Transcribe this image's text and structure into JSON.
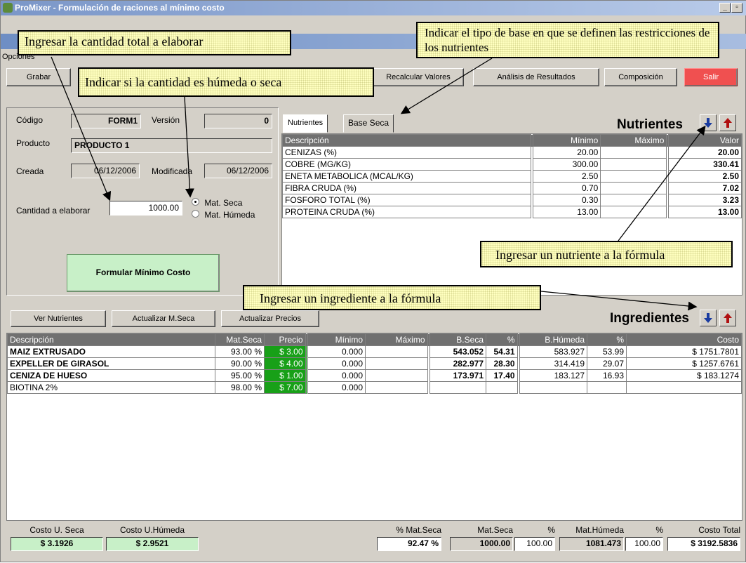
{
  "app": {
    "title": "ProMixer - Formulación de raciones al mínimo costo",
    "menu": "Opciones"
  },
  "toolbar": {
    "grabar": "Grabar",
    "recalcular": "Recalcular Valores",
    "analisis": "Análisis de Resultados",
    "composicion": "Composición",
    "salir": "Salir"
  },
  "form": {
    "codigo_label": "Código",
    "codigo_value": "FORM1",
    "version_label": "Versión",
    "version_value": "0",
    "producto_label": "Producto",
    "producto_value": "PRODUCTO 1",
    "creada_label": "Creada",
    "creada_value": "06/12/2006",
    "modificada_label": "Modificada",
    "modificada_value": "06/12/2006",
    "cantidad_label": "Cantidad a elaborar",
    "cantidad_value": "1000.00",
    "radio_seca": "Mat. Seca",
    "radio_humeda": "Mat. Húmeda",
    "formular_button": "Formular Mínimo Costo"
  },
  "nutrientes": {
    "tab_nutrientes": "Nutrientes",
    "tab_base_seca": "Base Seca",
    "title": "Nutrientes",
    "headers": [
      "Descripción",
      "Mínimo",
      "Máximo",
      "Valor"
    ],
    "rows": [
      {
        "desc": "CENIZAS (%)",
        "min": "20.00",
        "max": "",
        "valor": "20.00"
      },
      {
        "desc": "COBRE (MG/KG)",
        "min": "300.00",
        "max": "",
        "valor": "330.41"
      },
      {
        "desc": "ENETA METABOLICA (MCAL/KG)",
        "min": "2.50",
        "max": "",
        "valor": "2.50"
      },
      {
        "desc": "FIBRA CRUDA (%)",
        "min": "0.70",
        "max": "",
        "valor": "7.02"
      },
      {
        "desc": "FOSFORO TOTAL (%)",
        "min": "0.30",
        "max": "",
        "valor": "3.23"
      },
      {
        "desc": "PROTEINA CRUDA (%)",
        "min": "13.00",
        "max": "",
        "valor": "13.00"
      }
    ]
  },
  "ingredientes": {
    "ver_nutrientes": "Ver Nutrientes",
    "actualizar_mseca": "Actualizar M.Seca",
    "actualizar_precios": "Actualizar Precios",
    "title": "Ingredientes",
    "headers": [
      "Descripción",
      "Mat.Seca",
      "Precio",
      "Mínimo",
      "Máximo",
      "B.Seca",
      "%",
      "B.Húmeda",
      "%",
      "Costo"
    ],
    "rows": [
      {
        "desc": "MAIZ EXTRUSADO",
        "mseca": "93.00 %",
        "precio": "$ 3.00",
        "min": "0.000",
        "max": "",
        "bseca": "543.052",
        "pct1": "54.31",
        "bhumeda": "583.927",
        "pct2": "53.99",
        "costo": "$ 1751.7801"
      },
      {
        "desc": "EXPELLER DE GIRASOL",
        "mseca": "90.00 %",
        "precio": "$ 4.00",
        "min": "0.000",
        "max": "",
        "bseca": "282.977",
        "pct1": "28.30",
        "bhumeda": "314.419",
        "pct2": "29.07",
        "costo": "$ 1257.6761"
      },
      {
        "desc": "CENIZA DE HUESO",
        "mseca": "95.00 %",
        "precio": "$ 1.00",
        "min": "0.000",
        "max": "",
        "bseca": "173.971",
        "pct1": "17.40",
        "bhumeda": "183.127",
        "pct2": "16.93",
        "costo": "$ 183.1274"
      },
      {
        "desc": "BIOTINA 2%",
        "mseca": "98.00 %",
        "precio": "$ 7.00",
        "min": "0.000",
        "max": "",
        "bseca": "",
        "pct1": "",
        "bhumeda": "",
        "pct2": "",
        "costo": ""
      }
    ]
  },
  "footer": {
    "costo_seca_label": "Costo U. Seca",
    "costo_seca_value": "$ 3.1926",
    "costo_humeda_label": "Costo U.Húmeda",
    "costo_humeda_value": "$ 2.9521",
    "pct_mseca_label": "% Mat.Seca",
    "pct_mseca_value": "92.47 %",
    "mseca_label": "Mat.Seca",
    "mseca_value": "1000.00",
    "pct_label": "%",
    "pct1_value": "100.00",
    "mhumeda_label": "Mat.Húmeda",
    "mhumeda_value": "1081.473",
    "pct2_label": "%",
    "pct2_value": "100.00",
    "costo_total_label": "Costo Total",
    "costo_total_value": "$ 3192.5836"
  },
  "callouts": {
    "cantidad": "Ingresar la cantidad total a elaborar",
    "humeda_seca": "Indicar si la cantidad es húmeda o seca",
    "base": "Indicar el tipo de base en que se definen las restricciones de los nutrientes",
    "nutriente": "Ingresar un nutriente a la fórmula",
    "ingrediente": "Ingresar un ingrediente a la fórmula"
  },
  "colors": {
    "title_bar": "#7a96c8",
    "grid_header": "#707070",
    "price_green": "#18a018",
    "salir_red": "#f05050",
    "formular_green": "#c8f0c8",
    "callout_bg": "#ffffc0"
  }
}
